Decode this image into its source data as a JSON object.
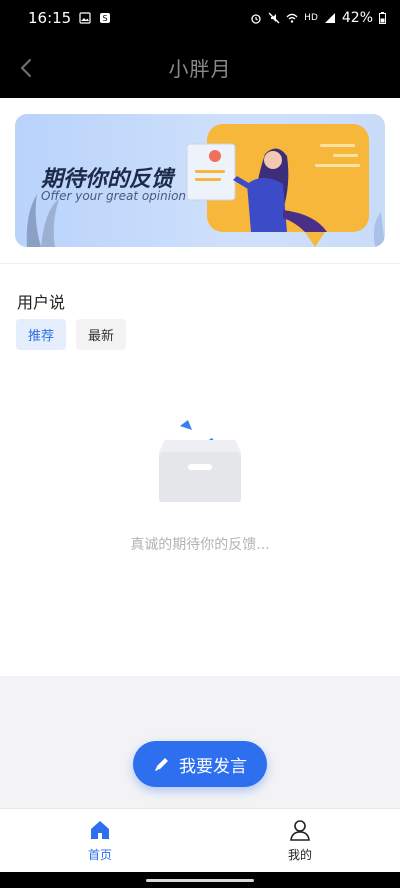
{
  "status_bar": {
    "time": "16:15",
    "battery": "42%",
    "network": "HD"
  },
  "nav": {
    "title": "小胖月"
  },
  "banner": {
    "title": "期待你的反馈",
    "subtitle": "Offer your great opinion"
  },
  "section": {
    "title": "用户说",
    "tabs": [
      {
        "label": "推荐",
        "active": true
      },
      {
        "label": "最新",
        "active": false
      }
    ]
  },
  "empty_state": {
    "text": "真诚的期待你的反馈..."
  },
  "post_button": {
    "label": "我要发言"
  },
  "tabbar": {
    "items": [
      {
        "label": "首页",
        "icon": "home-icon",
        "active": true
      },
      {
        "label": "我的",
        "icon": "user-icon",
        "active": false
      }
    ]
  },
  "colors": {
    "accent": "#2e6ff0",
    "nav_bg": "#000000",
    "tab_active_bg": "#e4eefc"
  }
}
